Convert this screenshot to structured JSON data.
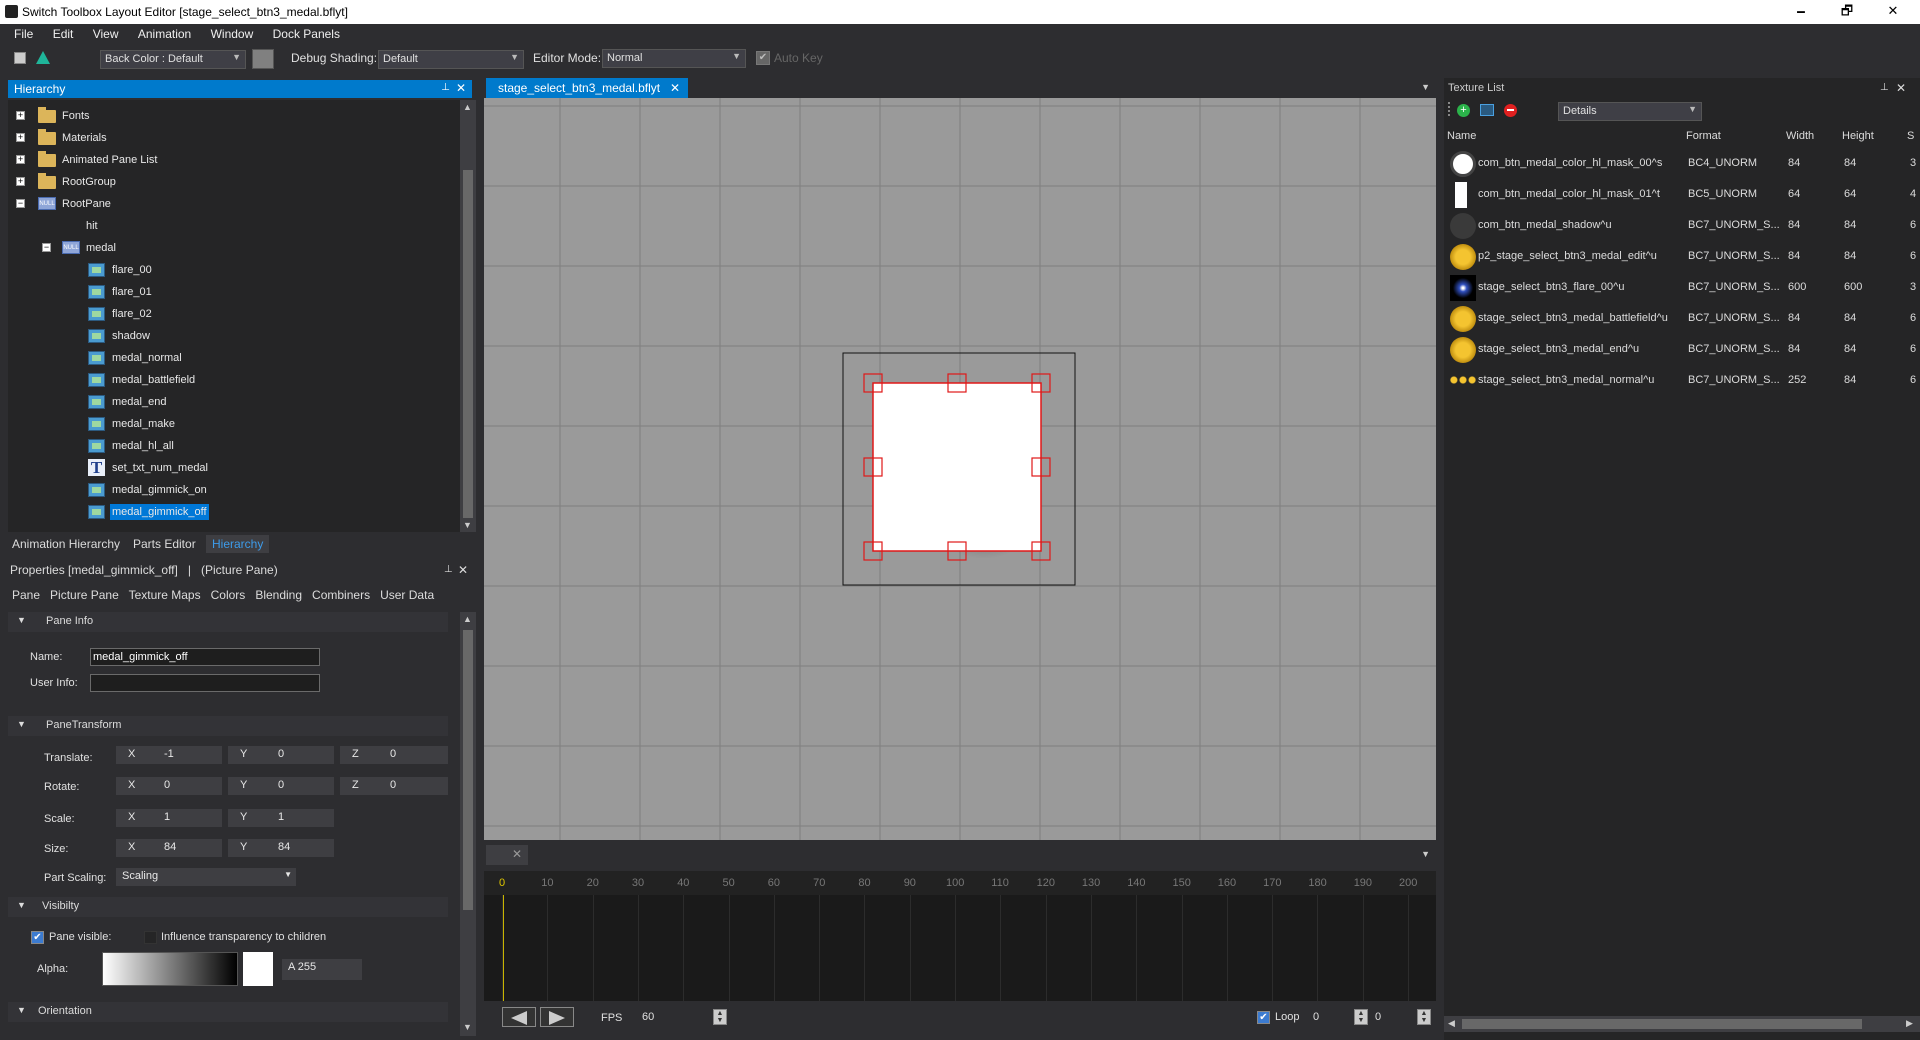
{
  "window": {
    "title": "Switch Toolbox Layout Editor [stage_select_btn3_medal.bflyt]",
    "minimize": "🗕",
    "maximize": "🗗",
    "close": "✕"
  },
  "menu": [
    "File",
    "Edit",
    "View",
    "Animation",
    "Window",
    "Dock Panels"
  ],
  "toolbar": {
    "back_color": "Back Color : Default",
    "debug_shading_label": "Debug Shading:",
    "debug_shading_value": "Default",
    "editor_mode_label": "Editor Mode:",
    "editor_mode_value": "Normal",
    "auto_key": "Auto Key",
    "back_color_swatch": "#808080"
  },
  "hierarchy": {
    "title": "Hierarchy",
    "pin": "📌",
    "close": "✕",
    "nodes": [
      {
        "label": "Fonts",
        "icon": "folder-icon",
        "expander": "+"
      },
      {
        "label": "Materials",
        "icon": "folder-icon",
        "expander": "+"
      },
      {
        "label": "Animated Pane List",
        "icon": "folder-icon",
        "expander": "+"
      },
      {
        "label": "RootGroup",
        "icon": "folder-icon",
        "expander": "+"
      },
      {
        "label": "RootPane",
        "icon": "null-pane-icon",
        "expander": "−"
      },
      {
        "label": "hit",
        "icon": "",
        "expander": ""
      },
      {
        "label": "medal",
        "icon": "null-pane-icon",
        "expander": "−"
      },
      {
        "label": "flare_00",
        "icon": "picture-pane-icon",
        "expander": ""
      },
      {
        "label": "flare_01",
        "icon": "picture-pane-icon",
        "expander": ""
      },
      {
        "label": "flare_02",
        "icon": "picture-pane-icon",
        "expander": ""
      },
      {
        "label": "shadow",
        "icon": "picture-pane-icon",
        "expander": ""
      },
      {
        "label": "medal_normal",
        "icon": "picture-pane-icon",
        "expander": ""
      },
      {
        "label": "medal_battlefield",
        "icon": "picture-pane-icon",
        "expander": ""
      },
      {
        "label": "medal_end",
        "icon": "picture-pane-icon",
        "expander": ""
      },
      {
        "label": "medal_make",
        "icon": "picture-pane-icon",
        "expander": ""
      },
      {
        "label": "medal_hl_all",
        "icon": "picture-pane-icon",
        "expander": ""
      },
      {
        "label": "set_txt_num_medal",
        "icon": "text-pane-icon",
        "expander": ""
      },
      {
        "label": "medal_gimmick_on",
        "icon": "picture-pane-icon",
        "expander": ""
      },
      {
        "label": "medal_gimmick_off",
        "icon": "picture-pane-icon",
        "expander": ""
      }
    ],
    "bottom_tabs": [
      "Animation Hierarchy",
      "Parts Editor",
      "Hierarchy"
    ]
  },
  "properties": {
    "title": "Properties [medal_gimmick_off]",
    "subtitle": "(Picture Pane)",
    "separator": "|",
    "tabs": [
      "Pane",
      "Picture Pane",
      "Texture Maps",
      "Colors",
      "Blending",
      "Combiners",
      "User Data"
    ],
    "pane_info": "Pane Info",
    "name_label": "Name:",
    "name_value": "medal_gimmick_off",
    "user_info_label": "User Info:",
    "user_info_value": "",
    "transform": "PaneTransform",
    "translate_label": "Translate:",
    "rotate_label": "Rotate:",
    "scale_label": "Scale:",
    "size_label": "Size:",
    "translate": {
      "x": "-1",
      "y": "0",
      "z": "0"
    },
    "rotate": {
      "x": "0",
      "y": "0",
      "z": "0"
    },
    "scale": {
      "x": "1",
      "y": "1"
    },
    "size": {
      "x": "84",
      "y": "84"
    },
    "axis_x": "X",
    "axis_y": "Y",
    "axis_z": "Z",
    "part_scaling_label": "Part Scaling:",
    "part_scaling_value": "Scaling",
    "visibility": "Visibilty",
    "pane_visible": "Pane visible:",
    "influence": "Influence transparency to children",
    "alpha_label": "Alpha:",
    "alpha_value": "A  255",
    "orientation": "Orientation"
  },
  "viewport": {
    "tab_label": "stage_select_btn3_medal.bflyt",
    "tab_close": "✕"
  },
  "timeline": {
    "ticks": [
      "0",
      "10",
      "20",
      "30",
      "40",
      "50",
      "60",
      "70",
      "80",
      "90",
      "100",
      "110",
      "120",
      "130",
      "140",
      "150",
      "160",
      "170",
      "180",
      "190",
      "200"
    ],
    "fps_label": "FPS",
    "fps_value": "60",
    "loop_label": "Loop",
    "loop_value": "0",
    "frame_value": "0",
    "close": "✕"
  },
  "texture_list": {
    "title": "Texture List",
    "view_mode": "Details",
    "columns": [
      "Name",
      "Format",
      "Width",
      "Height",
      "S"
    ],
    "rows": [
      {
        "name": "com_btn_medal_color_hl_mask_00^s",
        "format": "BC4_UNORM",
        "width": "84",
        "height": "84",
        "s": "3"
      },
      {
        "name": "com_btn_medal_color_hl_mask_01^t",
        "format": "BC5_UNORM",
        "width": "64",
        "height": "64",
        "s": "4"
      },
      {
        "name": "com_btn_medal_shadow^u",
        "format": "BC7_UNORM_S...",
        "width": "84",
        "height": "84",
        "s": "6"
      },
      {
        "name": "p2_stage_select_btn3_medal_edit^u",
        "format": "BC7_UNORM_S...",
        "width": "84",
        "height": "84",
        "s": "6"
      },
      {
        "name": "stage_select_btn3_flare_00^u",
        "format": "BC7_UNORM_S...",
        "width": "600",
        "height": "600",
        "s": "3"
      },
      {
        "name": "stage_select_btn3_medal_battlefield^u",
        "format": "BC7_UNORM_S...",
        "width": "84",
        "height": "84",
        "s": "6"
      },
      {
        "name": "stage_select_btn3_medal_end^u",
        "format": "BC7_UNORM_S...",
        "width": "84",
        "height": "84",
        "s": "6"
      },
      {
        "name": "stage_select_btn3_medal_normal^u",
        "format": "BC7_UNORM_S...",
        "width": "252",
        "height": "84",
        "s": "6"
      }
    ]
  }
}
